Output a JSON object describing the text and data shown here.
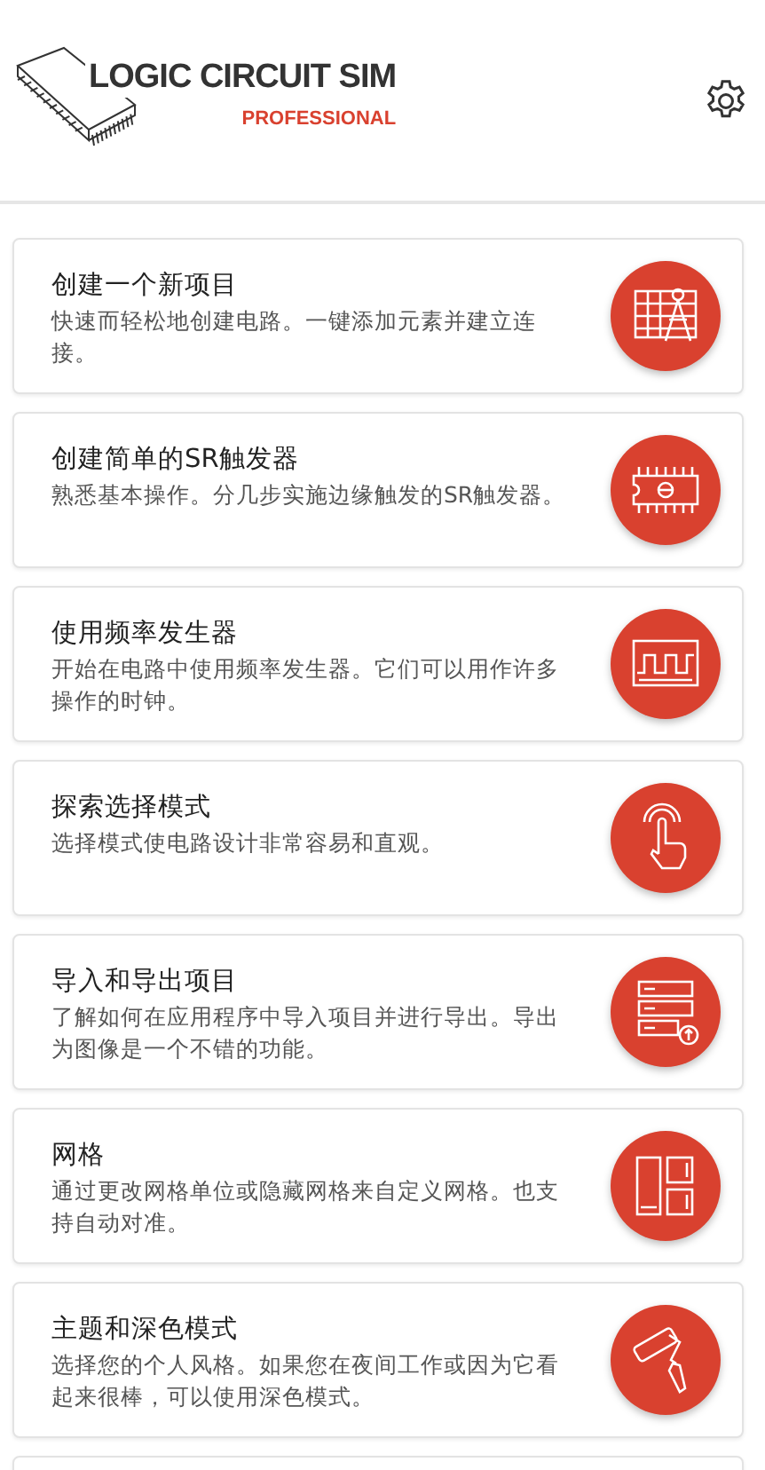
{
  "header": {
    "logo_title": "LOGIC CIRCUIT SIM",
    "logo_subtitle": "PROFESSIONAL"
  },
  "cards": [
    {
      "title": "创建一个新项目",
      "description": "快速而轻松地创建电路。一键添加元素并建立连接。",
      "kind": "blueprint"
    },
    {
      "title": "创建简单的SR触发器",
      "description": "熟悉基本操作。分几步实施边缘触发的SR触发器。",
      "kind": "chip"
    },
    {
      "title": "使用频率发生器",
      "description": "开始在电路中使用频率发生器。它们可以用作许多操作的时钟。",
      "kind": "wave"
    },
    {
      "title": "探索选择模式",
      "description": "选择模式使电路设计非常容易和直观。",
      "kind": "touch"
    },
    {
      "title": "导入和导出项目",
      "description": "了解如何在应用程序中导入项目并进行导出。导出为图像是一个不错的功能。",
      "kind": "server"
    },
    {
      "title": "网格",
      "description": "通过更改网格单位或隐藏网格来自定义网格。也支持自动对准。",
      "kind": "grid"
    },
    {
      "title": "主题和深色模式",
      "description": "选择您的个人风格。如果您在夜间工作或因为它看起来很棒，可以使用深色模式。",
      "kind": "roller"
    }
  ]
}
